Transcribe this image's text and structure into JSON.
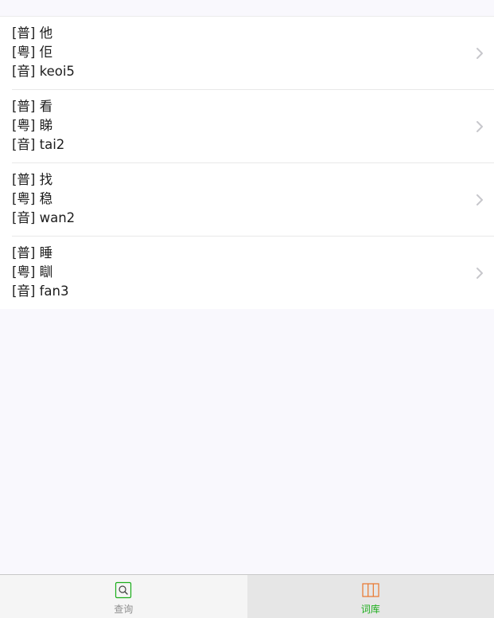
{
  "entries": [
    {
      "putonghua": "[普] 他",
      "cantonese": "[粤] 佢",
      "pronunciation": "[音] keoi5"
    },
    {
      "putonghua": "[普] 看",
      "cantonese": "[粤] 睇",
      "pronunciation": "[音] tai2"
    },
    {
      "putonghua": "[普] 找",
      "cantonese": "[粤] 稳",
      "pronunciation": "[音] wan2"
    },
    {
      "putonghua": "[普] 睡",
      "cantonese": "[粤] 瞓",
      "pronunciation": "[音] fan3"
    }
  ],
  "tabbar": {
    "tabs": [
      {
        "label": "查询",
        "icon": "search-icon",
        "active": false
      },
      {
        "label": "词库",
        "icon": "library-icon",
        "active": true
      }
    ]
  },
  "colors": {
    "active_tab_text": "#1aad19",
    "search_icon": "#1aad19",
    "library_icon": "#e8762c",
    "chevron": "#c7c7cc"
  }
}
